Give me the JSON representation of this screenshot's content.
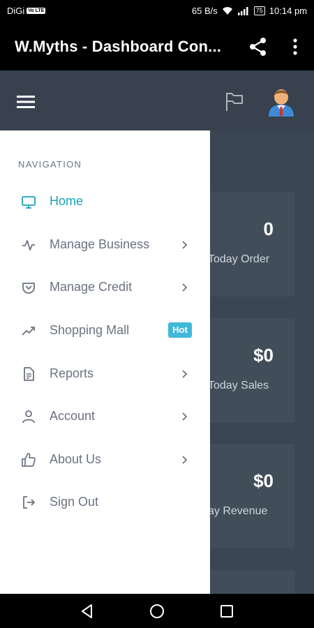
{
  "status_bar": {
    "carrier": "DiGi",
    "carrier_badge": "Vo LTE",
    "speed": "65 B/s",
    "battery": "75",
    "time": "10:14 pm"
  },
  "app_bar": {
    "title": "W.Myths - Dashboard Con...",
    "share_icon": "share-icon",
    "more_icon": "more-vert-icon"
  },
  "dashboard": {
    "cards": [
      {
        "value": "0",
        "label": "Today Order"
      },
      {
        "value": "$0",
        "label": "Today Sales"
      },
      {
        "value": "$0",
        "label": "ay Revenue"
      }
    ]
  },
  "drawer": {
    "heading": "NAVIGATION",
    "items": [
      {
        "label": "Home",
        "icon": "monitor-icon",
        "active": true,
        "chevron": false
      },
      {
        "label": "Manage Business",
        "icon": "activity-icon",
        "active": false,
        "chevron": true
      },
      {
        "label": "Manage Credit",
        "icon": "pocket-icon",
        "active": false,
        "chevron": true
      },
      {
        "label": "Shopping Mall",
        "icon": "trending-up-icon",
        "active": false,
        "chevron": false,
        "badge": "Hot"
      },
      {
        "label": "Reports",
        "icon": "file-text-icon",
        "active": false,
        "chevron": true
      },
      {
        "label": "Account",
        "icon": "user-icon",
        "active": false,
        "chevron": true
      },
      {
        "label": "About Us",
        "icon": "thumbs-up-icon",
        "active": false,
        "chevron": true
      },
      {
        "label": "Sign Out",
        "icon": "log-out-icon",
        "active": false,
        "chevron": false
      }
    ]
  },
  "colors": {
    "accent": "#17a2b8",
    "badge": "#3fb8d9",
    "dashboard_bg": "#3a4652",
    "card_bg": "#414d59"
  }
}
